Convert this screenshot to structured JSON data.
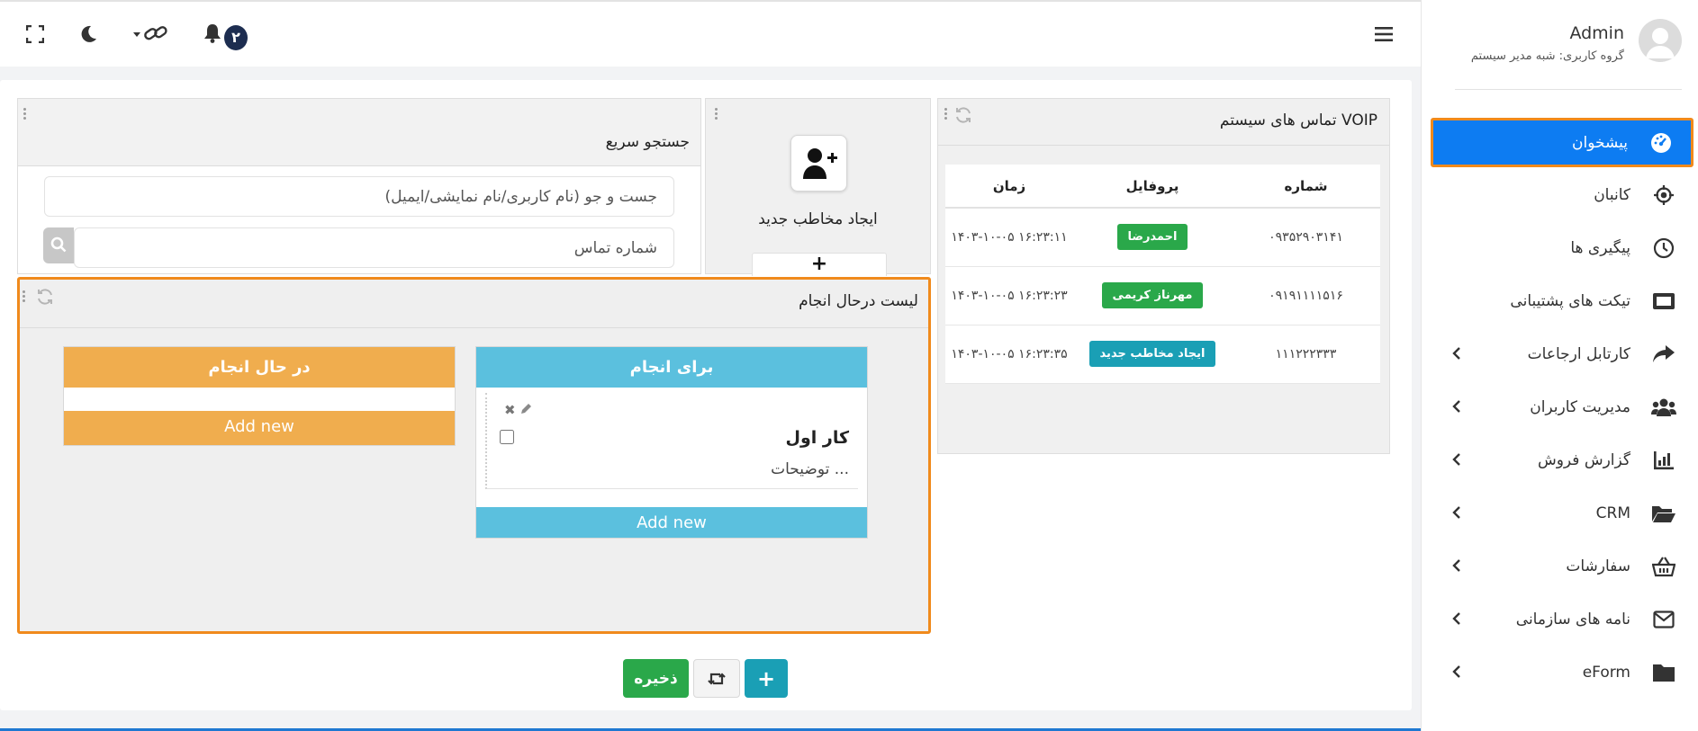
{
  "topbar": {
    "notification_count": "۲"
  },
  "sidebar": {
    "user_name": "Admin",
    "user_group": "گروه کاربری: شبه مدیر سیستم",
    "items": [
      {
        "label": "پیشخوان",
        "icon": "dashboard-icon",
        "active": true
      },
      {
        "label": "کانبان",
        "icon": "crosshair-icon"
      },
      {
        "label": "پیگیری ها",
        "icon": "clock-icon"
      },
      {
        "label": "تیکت های پشتیبانی",
        "icon": "ticket-icon"
      },
      {
        "label": "کارتابل ارجاعات",
        "icon": "share-arrow-icon",
        "chevron": true
      },
      {
        "label": "مدیریت کاربران",
        "icon": "users-icon",
        "chevron": true
      },
      {
        "label": "گزارش فروش",
        "icon": "chart-icon",
        "chevron": true
      },
      {
        "label": "CRM",
        "icon": "folder-open-icon",
        "chevron": true
      },
      {
        "label": "سفارشات",
        "icon": "basket-icon",
        "chevron": true
      },
      {
        "label": "نامه های سازمانی",
        "icon": "envelope-icon",
        "chevron": true
      },
      {
        "label": "eForm",
        "icon": "folder-icon",
        "chevron": true
      }
    ]
  },
  "voip": {
    "title": "تماس های سیستم VOIP",
    "columns": {
      "number": "شماره",
      "profile": "پروفایل",
      "time": "زمان"
    },
    "rows": [
      {
        "number": "۰۹۳۵۲۹۰۳۱۴۱",
        "profile": "احمدرضا",
        "profile_color": "#2aa84a",
        "time": "۱۴۰۳-۱۰-۰۵ ۱۶:۲۳:۱۱"
      },
      {
        "number": "۰۹۱۹۱۱۱۱۵۱۶",
        "profile": "مهرناز کریمی",
        "profile_color": "#2aa84a",
        "time": "۱۴۰۳-۱۰-۰۵ ۱۶:۲۳:۲۳"
      },
      {
        "number": "۱۱۱۲۲۲۳۳۳",
        "profile": "ایجاد مخاطب جدید",
        "profile_color": "#1a9fb5",
        "time": "۱۴۰۳-۱۰-۰۵ ۱۶:۲۳:۳۵"
      }
    ]
  },
  "new_contact": {
    "label": "ایجاد مخاطب جدید",
    "plus": "+"
  },
  "quick_search": {
    "title": "جستجو سریع",
    "search_placeholder": "جست و جو (نام کاربری/نام نمایشی/ایمیل)",
    "phone_placeholder": "شماره تماس"
  },
  "todo": {
    "title": "لیست درحال انجام",
    "columns": [
      {
        "title": "برای انجام",
        "color": "#5bc0de",
        "add_label": "Add new",
        "cards": [
          {
            "title": "کار اول",
            "desc": "توضیحات ..."
          }
        ]
      },
      {
        "title": "در حال انجام",
        "color": "#f0ad4e",
        "add_label": "Add new",
        "cards": []
      }
    ]
  },
  "actions": {
    "save_label": "ذخیره",
    "add_label": "+"
  }
}
